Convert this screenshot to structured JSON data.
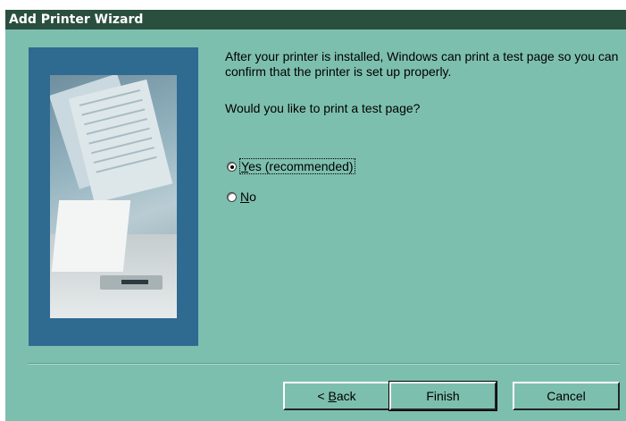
{
  "window": {
    "title": "Add Printer Wizard"
  },
  "content": {
    "intro": "After your printer is installed, Windows can print a test page so you can confirm that the printer is set up properly.",
    "question": "Would you like to print a test page?",
    "options": [
      {
        "label_mnemonic": "Y",
        "label_rest": "es (recommended)",
        "selected": true
      },
      {
        "label_mnemonic": "N",
        "label_rest": "o",
        "selected": false
      }
    ]
  },
  "buttons": {
    "back_prefix": "< ",
    "back_mnemonic": "B",
    "back_rest": "ack",
    "finish": "Finish",
    "cancel": "Cancel"
  },
  "colors": {
    "dialog_bg": "#7dbfae",
    "titlebar_bg": "#2a4f3e",
    "illustration_frame": "#2f6a91"
  },
  "illustration": "printer-with-pages-image"
}
